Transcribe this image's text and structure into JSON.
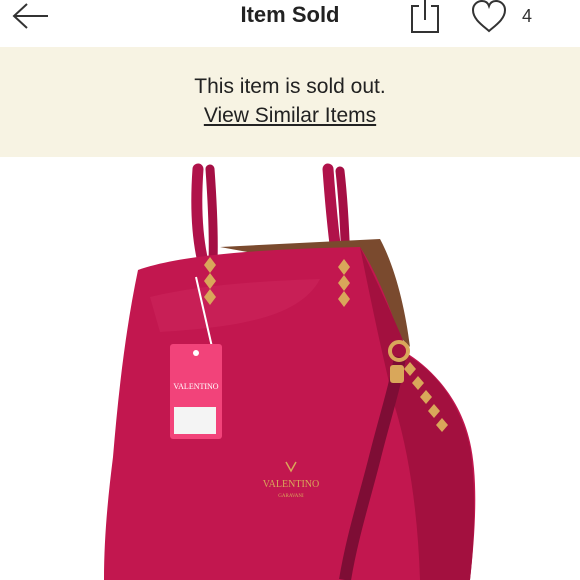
{
  "header": {
    "title": "Item Sold",
    "back_icon": "arrow-left-icon",
    "share_icon": "share-icon",
    "like_icon": "heart-icon",
    "like_count": "4"
  },
  "banner": {
    "message": "This item is sold out.",
    "link_label": "View Similar Items",
    "background": "#f7f3e3"
  },
  "product": {
    "image_subject": "pink leather tote bag",
    "bag_color": "#c2174f",
    "tag_color": "#f2437a"
  }
}
